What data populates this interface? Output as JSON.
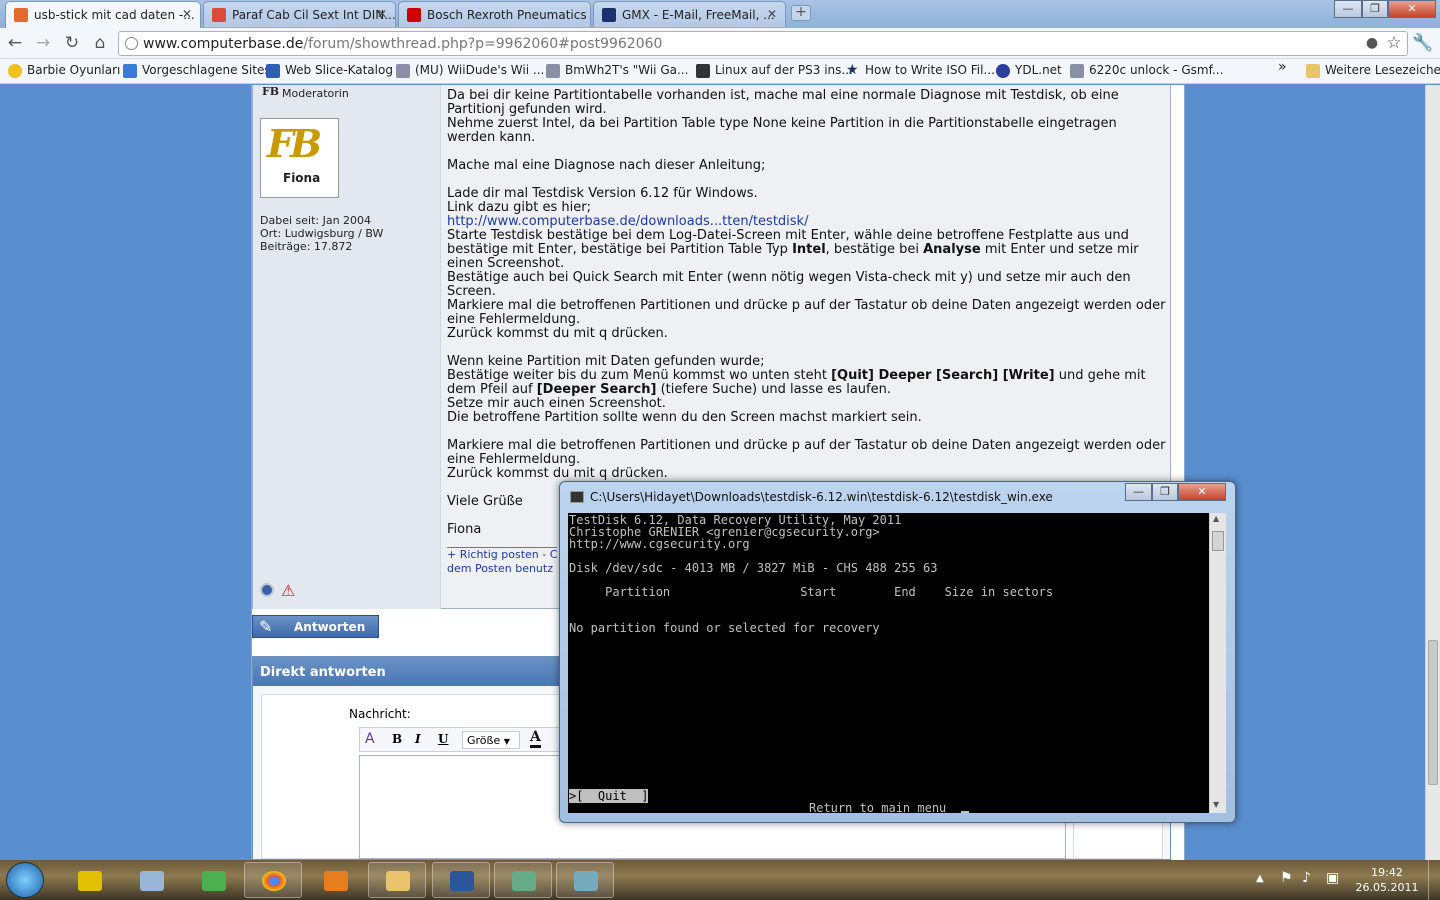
{
  "tabs": [
    {
      "title": "usb-stick mit cad daten -...",
      "active": true
    },
    {
      "title": "Paraf Cab Cil Sext Int DIN..."
    },
    {
      "title": "Bosch Rexroth Pneumatics"
    },
    {
      "title": "GMX - E-Mail, FreeMail, ..."
    }
  ],
  "window_buttons": {
    "minimize": "—",
    "maximize": "❐",
    "close": "✕"
  },
  "address": {
    "host": "www.computerbase.de",
    "path": "/forum/showthread.php?p=9962060#post9962060"
  },
  "bookmarks": [
    "Barbie Oyunları",
    "Vorgeschlagene Sites",
    "Web Slice-Katalog",
    "(MU) WiiDude's Wii ...",
    "BmWh2T's \"Wii Ga...",
    "Linux auf der PS3 ins...",
    "How to Write ISO Fil...",
    "YDL.net",
    "6220c unlock - Gsmf..."
  ],
  "bookmarks_more": "»",
  "other_bookmarks": "Weitere Lesezeichen",
  "user": {
    "rank": "Moderatorin",
    "avatar_text": "Fiona",
    "joined": "Dabei seit: Jan 2004",
    "location": "Ort: Ludwigsburg / BW",
    "posts": "Beiträge: 17.872"
  },
  "post": {
    "p1": "Da bei dir keine Partitiontabelle vorhanden ist, mache mal eine normale Diagnose mit Testdisk, ob eine Partitionj gefunden wird.",
    "p2": "Nehme zuerst Intel, da bei Partition Table type None keine Partition in die Partitionstabelle eingetragen werden kann.",
    "p3": "Mache mal eine Diagnose nach dieser Anleitung;",
    "p4": "Lade dir mal Testdisk Version 6.12 für Windows.",
    "p5": "Link dazu gibt es hier;",
    "link": "http://www.computerbase.de/downloads...tten/testdisk/",
    "p6a": "Starte Testdisk bestätige bei dem Log-Datei-Screen mit Enter, wähle deine betroffene Festplatte aus und bestätige mit Enter, bestätige bei Partition Table Typ ",
    "p6b": "Intel",
    "p6c": ", bestätige bei ",
    "p6d": "Analyse",
    "p6e": " mit Enter und setze mir einen Screenshot.",
    "p7": "Bestätige auch bei Quick Search mit Enter (wenn nötig wegen Vista-check mit y) und setze mir auch den Screen.",
    "p8": "Markiere mal die betroffenen Partitionen und drücke p auf der Tastatur ob deine Daten angezeigt werden oder eine Fehlermeldung.",
    "p9": "Zurück kommst du mit q drücken.",
    "p10": "Wenn keine Partition mit Daten gefunden wurde;",
    "p11a": "Bestätige weiter bis du zum Menü kommst wo unten steht ",
    "p11b": "[Quit] Deeper [Search] [Write]",
    "p11c": " und gehe mit dem Pfeil auf ",
    "p11d": "[Deeper Search]",
    "p11e": " (tiefere Suche) und lasse es laufen.",
    "p12": "Setze mir auch einen Screenshot.",
    "p13": "Die betroffene Partition sollte wenn du den Screen machst markiert sein.",
    "p14": "Markiere mal die betroffenen Partitionen und drücke p auf der Tastatur ob deine Daten angezeigt werden oder eine Fehlermeldung.",
    "p15": "Zurück kommst du mit q drücken.",
    "greeting": "Viele Grüße",
    "signature": "Fiona",
    "footer1": "+ Richtig posten - C",
    "footer2": "dem Posten benutz"
  },
  "reply_button": "Antworten",
  "direct_reply": {
    "title": "Direkt antworten",
    "message_label": "Nachricht:",
    "size_select": "Größe"
  },
  "console": {
    "title": "C:\\Users\\Hidayet\\Downloads\\testdisk-6.12.win\\testdisk-6.12\\testdisk_win.exe",
    "lines": [
      "TestDisk 6.12, Data Recovery Utility, May 2011",
      "Christophe GRENIER <grenier@cgsecurity.org>",
      "http://www.cgsecurity.org",
      "Disk /dev/sdc - 4013 MB / 3827 MiB - CHS 488 255 63",
      "     Partition                  Start        End    Size in sectors",
      "No partition found or selected for recovery",
      ">[  Quit  ]",
      "Return to main menu"
    ]
  },
  "clock": {
    "time": "19:42",
    "date": "26.05.2011"
  }
}
